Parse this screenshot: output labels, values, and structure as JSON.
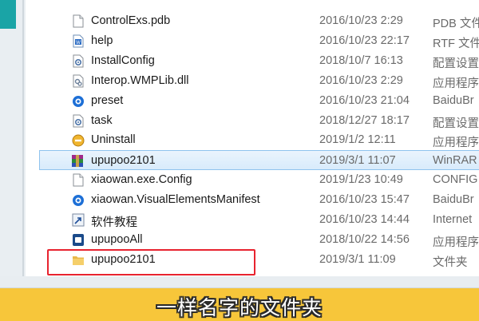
{
  "files": [
    {
      "name": "ControlExs.pdb",
      "date": "2016/10/23 2:29",
      "type": "PDB 文件",
      "icon": "generic-file-icon"
    },
    {
      "name": "help",
      "date": "2016/10/23 22:17",
      "type": "RTF 文件",
      "icon": "rtf-document-icon"
    },
    {
      "name": "InstallConfig",
      "date": "2018/10/7 16:13",
      "type": "配置设置",
      "icon": "config-settings-icon"
    },
    {
      "name": "Interop.WMPLib.dll",
      "date": "2016/10/23 2:29",
      "type": "应用程序",
      "icon": "dll-extension-icon"
    },
    {
      "name": "preset",
      "date": "2016/10/23 21:04",
      "type": "BaiduBr",
      "icon": "baidu-browser-icon"
    },
    {
      "name": "task",
      "date": "2018/12/27 18:17",
      "type": "配置设置",
      "icon": "config-settings-icon"
    },
    {
      "name": "Uninstall",
      "date": "2019/1/2 12:11",
      "type": "应用程序",
      "icon": "uninstall-icon"
    },
    {
      "name": "upupoo2101",
      "date": "2019/3/1 11:07",
      "type": "WinRAR",
      "icon": "winrar-archive-icon",
      "selected": true
    },
    {
      "name": "xiaowan.exe.Config",
      "date": "2019/1/23 10:49",
      "type": "CONFIG",
      "icon": "blank-file-icon"
    },
    {
      "name": "xiaowan.VisualElementsManifest",
      "date": "2016/10/23 15:47",
      "type": "BaiduBr",
      "icon": "baidu-browser-icon"
    },
    {
      "name": "软件教程",
      "date": "2016/10/23 14:44",
      "type": "Internet",
      "icon": "internet-shortcut-icon"
    },
    {
      "name": "upupooAll",
      "date": "2018/10/22 14:56",
      "type": "应用程序",
      "icon": "app-executable-icon"
    },
    {
      "name": "upupoo2101",
      "date": "2019/3/1 11:09",
      "type": "文件夹",
      "icon": "folder-icon"
    }
  ],
  "caption": "一样名字的文件夹",
  "colors": {
    "highlight": "#e8232f",
    "caption_bg": "#f7c63a",
    "selection": "#d8ebfb"
  }
}
